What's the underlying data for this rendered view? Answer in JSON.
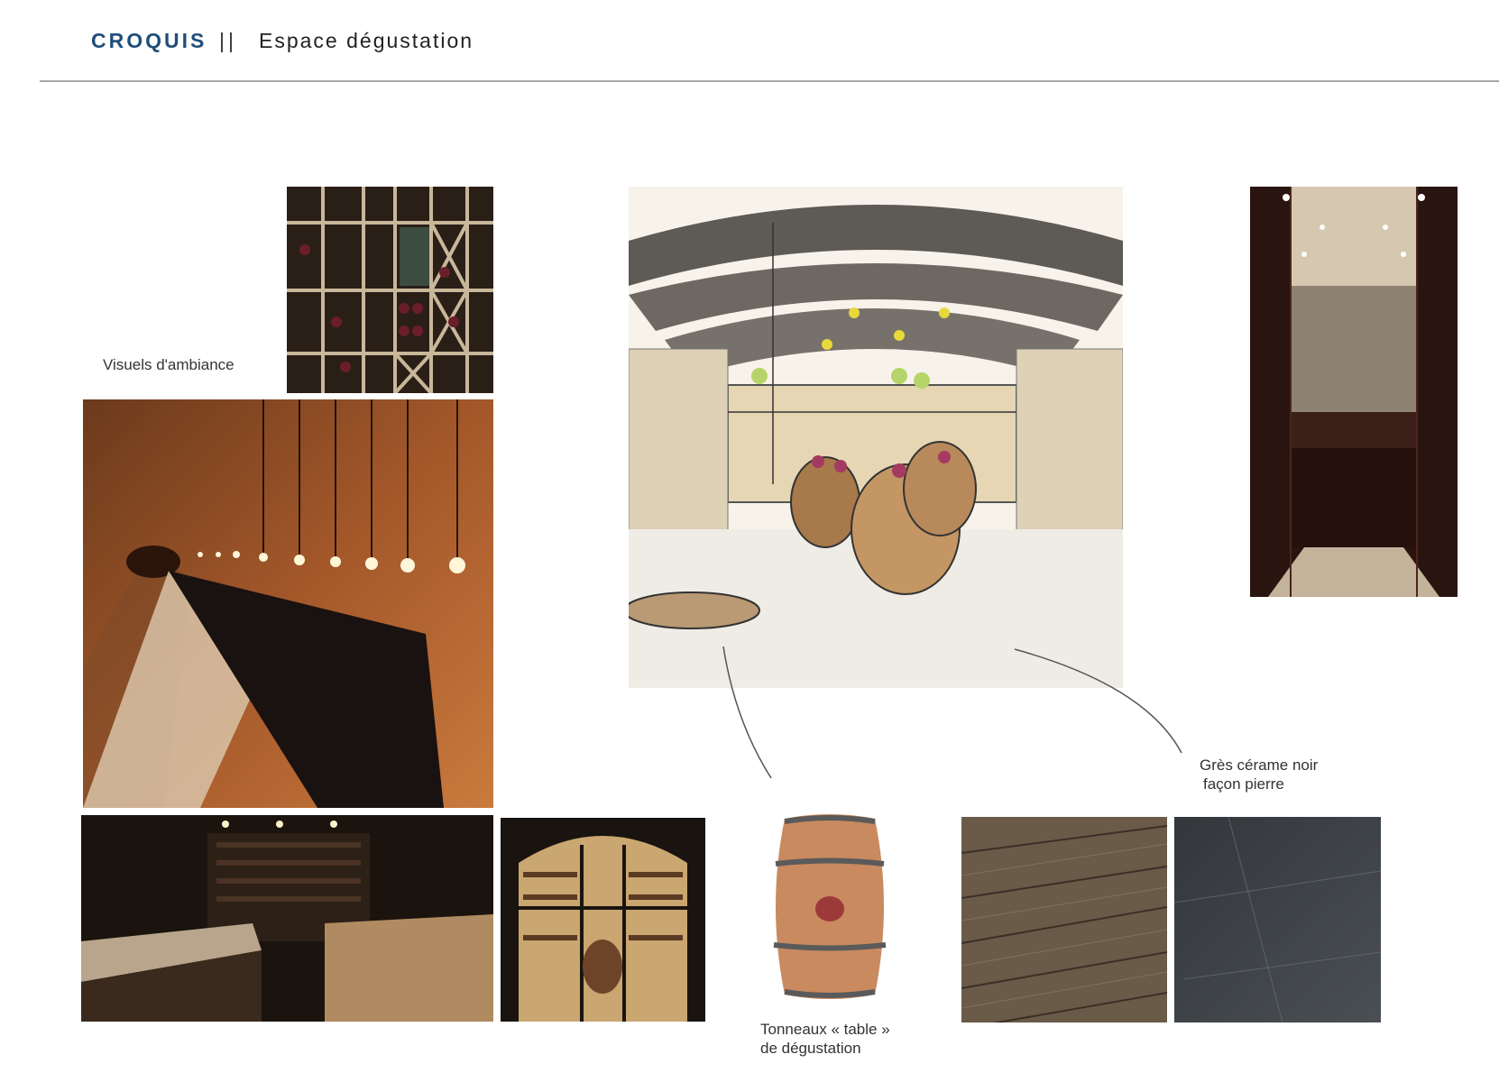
{
  "header": {
    "title": "CROQUIS",
    "separator": "||",
    "subtitle": "Espace dégustation"
  },
  "labels": {
    "ambiance": "Visuels d'ambiance",
    "tiles_line1": "Grès cérame noir",
    "tiles_line2": "façon pierre",
    "barrel_line1": "Tonneaux « table »",
    "barrel_line2": "de dégustation"
  },
  "colors": {
    "title_blue": "#1f4e79",
    "rule_gray": "#a8a8a8"
  }
}
